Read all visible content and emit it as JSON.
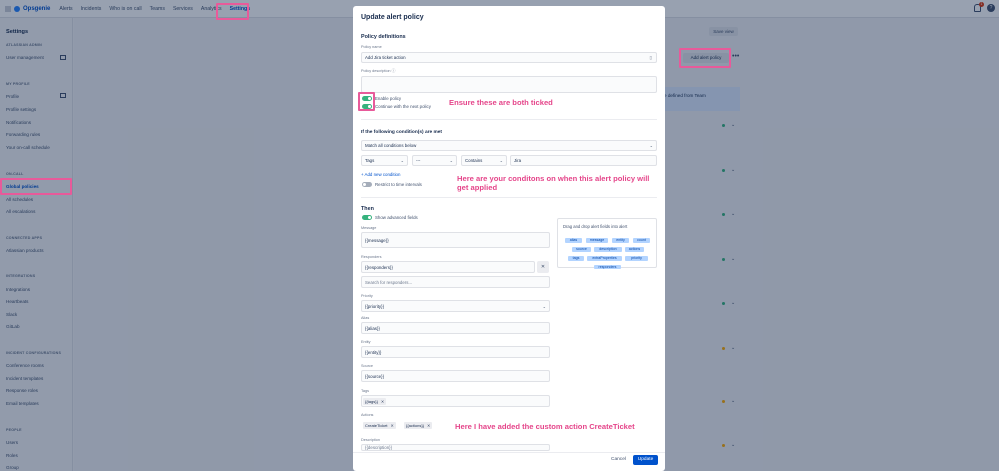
{
  "app": {
    "name": "Opsgenie"
  },
  "nav": [
    "Alerts",
    "Incidents",
    "Who is on call",
    "Teams",
    "Services",
    "Analytics",
    "Settings"
  ],
  "notifications_badge": "1",
  "sidebar": {
    "title": "Settings",
    "sections": [
      {
        "header": "ATLASSIAN ADMIN",
        "items": [
          "User management"
        ]
      },
      {
        "header": "MY PROFILE",
        "items": [
          "Profile",
          "Profile settings",
          "Notifications",
          "Forwarding rules",
          "Your on-call schedule"
        ]
      },
      {
        "header": "ON-CALL",
        "items": [
          "Global policies",
          "All schedules",
          "All escalations"
        ]
      },
      {
        "header": "CONNECTED APPS",
        "items": [
          "Atlassian products"
        ]
      },
      {
        "header": "INTEGRATIONS",
        "items": [
          "Integrations",
          "Heartbeats",
          "Slack",
          "GitLab"
        ]
      },
      {
        "header": "INCIDENT CONFIGURATIONS",
        "items": [
          "Conference rooms",
          "Incident templates",
          "Response roles",
          "Email templates"
        ]
      },
      {
        "header": "PEOPLE",
        "items": [
          "Users",
          "Roles",
          "Group"
        ]
      }
    ]
  },
  "background": {
    "save_view": "Save view",
    "add_alert_policy": "Add alert policy",
    "banner_text": "e defined from Team"
  },
  "modal": {
    "title": "Update alert policy",
    "section_definitions": "Policy definitions",
    "policy_name_label": "Policy name",
    "policy_name_value": "Add Jira ticket action",
    "policy_description_label": "Policy description",
    "enable_policy": "Enable policy",
    "continue_next": "Continue with the next policy",
    "conditions_header": "If the following condition(s) are met",
    "match_select": "Match all conditions below",
    "cond_field": "Tags",
    "cond_not": "---",
    "cond_op": "Contains",
    "cond_value": "Jira",
    "add_condition": "+ Add new condition",
    "restrict_time": "Restrict to time intervals",
    "then_header": "Then",
    "show_advanced": "Show advanced fields",
    "message_label": "Message",
    "message_value": "{{message}}",
    "responders_label": "Responders",
    "responders_value": "{{responders}}",
    "responders_search_ph": "Search for responders...",
    "priority_label": "Priority",
    "priority_value": "{{priority}}",
    "alias_label": "Alias",
    "alias_value": "{{alias}}",
    "entity_label": "Entity",
    "entity_value": "{{entity}}",
    "source_label": "Source",
    "source_value": "{{source}}",
    "tags_label": "Tags",
    "tags_chip": "{{tags}}",
    "actions_label": "Actions",
    "actions_chips": [
      "CreateTicket",
      "{{actions}}"
    ],
    "description_label": "Description",
    "description_value": "{{description}}",
    "drag_header": "Drag and drop alert fields into alert",
    "drag_fields": [
      "alias",
      "message",
      "entity",
      "count",
      "source",
      "description",
      "actions",
      "tags",
      "extraProperties",
      "priority",
      "responders"
    ],
    "cancel": "Cancel",
    "update": "Update"
  },
  "annotations": {
    "tick": "Ensure these are both ticked",
    "conditions": "Here are your conditons on when this alert policy will get applied",
    "action": "Here I have added the custom action CreateTicket"
  }
}
